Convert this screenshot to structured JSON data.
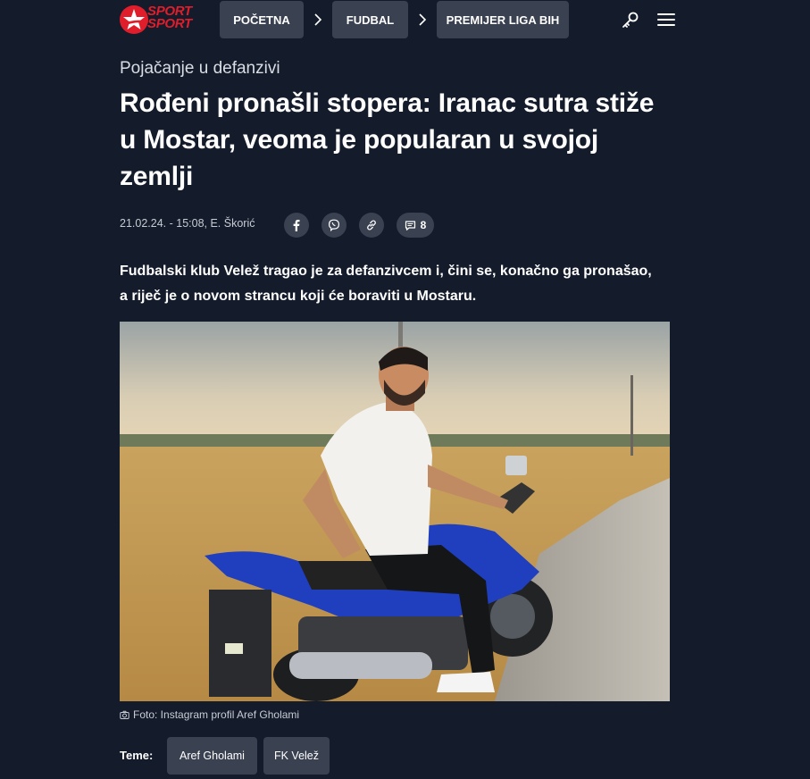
{
  "brand": {
    "logo_text_line1": "SPORT",
    "logo_text_line2": "SPORT",
    "accent_color": "#e01e2b",
    "logo_icon": "star-icon"
  },
  "nav": {
    "breadcrumbs": [
      {
        "label": "POČETNA"
      },
      {
        "label": "FUDBAL"
      },
      {
        "label": "PREMIJER LIGA BIH"
      }
    ],
    "separator_icon": "chevron-right-icon",
    "search_icon": "key-icon",
    "menu_icon": "hamburger-menu-icon"
  },
  "article": {
    "kicker": "Pojačanje u defanzivi",
    "headline": "Rođeni pronašli stopera: Iranac sutra stiže u Mostar, veoma je popularan u svojoj zemlji",
    "meta": "21.02.24. - 15:08, E. Škorić",
    "share": {
      "facebook_icon": "facebook-icon",
      "viber_icon": "viber-icon",
      "link_icon": "link-icon",
      "comments_icon": "comment-icon",
      "comments_count": "8"
    },
    "lead": "Fudbalski klub Velež tragao je za defanzivcem i, čini se, konačno ga pronašao, a riječ je o novom strancu koji će boraviti u Mostaru.",
    "caption": "Foto: Instagram profil Aref Gholami",
    "caption_icon": "camera-icon",
    "tags_label": "Teme:",
    "tags": [
      {
        "label": "Aref Gholami"
      },
      {
        "label": "FK Velež"
      }
    ]
  },
  "colors": {
    "background": "#141b2b",
    "button_bg": "#3a4150",
    "text": "#ffffff",
    "muted_text": "#c7ccd4"
  }
}
